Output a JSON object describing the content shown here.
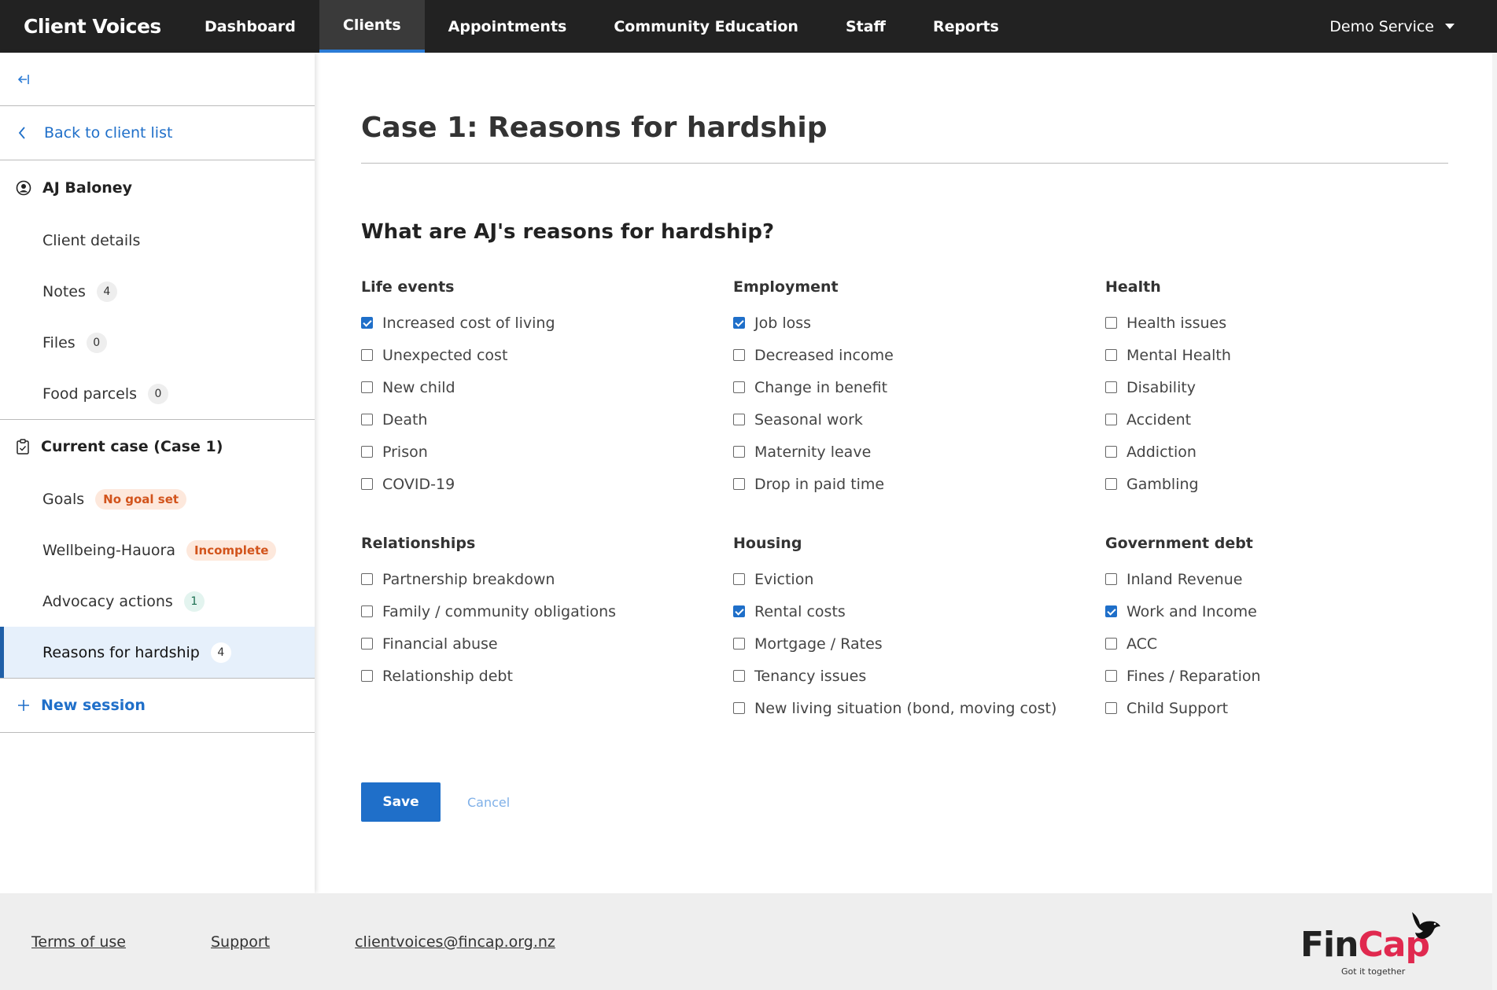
{
  "nav": {
    "brand": "Client Voices",
    "links": [
      "Dashboard",
      "Clients",
      "Appointments",
      "Community Education",
      "Staff",
      "Reports"
    ],
    "active": "Clients",
    "account": "Demo Service"
  },
  "sidebar": {
    "collapse_icon": "collapse-left-icon",
    "back": "Back to client list",
    "client_name": "AJ Baloney",
    "client_items": [
      {
        "label": "Client details"
      },
      {
        "label": "Notes",
        "count": "4"
      },
      {
        "label": "Files",
        "count": "0"
      },
      {
        "label": "Food parcels",
        "count": "0"
      }
    ],
    "case_title": "Current case (Case 1)",
    "case_items": [
      {
        "label": "Goals",
        "badge": "No goal set"
      },
      {
        "label": "Wellbeing-Hauora",
        "badge": "Incomplete"
      },
      {
        "label": "Advocacy actions",
        "count": "1"
      },
      {
        "label": "Reasons for hardship",
        "count": "4"
      }
    ],
    "new_session": "New session"
  },
  "main": {
    "title": "Case 1: Reasons for hardship",
    "question": "What are AJ's reasons for hardship?",
    "groups": [
      {
        "title": "Life events",
        "options": [
          {
            "label": "Increased cost of living",
            "checked": true
          },
          {
            "label": "Unexpected cost",
            "checked": false
          },
          {
            "label": "New child",
            "checked": false
          },
          {
            "label": "Death",
            "checked": false
          },
          {
            "label": "Prison",
            "checked": false
          },
          {
            "label": "COVID-19",
            "checked": false
          }
        ]
      },
      {
        "title": "Employment",
        "options": [
          {
            "label": "Job loss",
            "checked": true
          },
          {
            "label": "Decreased income",
            "checked": false
          },
          {
            "label": "Change in benefit",
            "checked": false
          },
          {
            "label": "Seasonal work",
            "checked": false
          },
          {
            "label": "Maternity leave",
            "checked": false
          },
          {
            "label": "Drop in paid time",
            "checked": false
          }
        ]
      },
      {
        "title": "Health",
        "options": [
          {
            "label": "Health issues",
            "checked": false
          },
          {
            "label": "Mental Health",
            "checked": false
          },
          {
            "label": "Disability",
            "checked": false
          },
          {
            "label": "Accident",
            "checked": false
          },
          {
            "label": "Addiction",
            "checked": false
          },
          {
            "label": "Gambling",
            "checked": false
          }
        ]
      },
      {
        "title": "Relationships",
        "options": [
          {
            "label": "Partnership breakdown",
            "checked": false
          },
          {
            "label": "Family / community obligations",
            "checked": false
          },
          {
            "label": "Financial abuse",
            "checked": false
          },
          {
            "label": "Relationship debt",
            "checked": false
          }
        ]
      },
      {
        "title": "Housing",
        "options": [
          {
            "label": "Eviction",
            "checked": false
          },
          {
            "label": "Rental costs",
            "checked": true
          },
          {
            "label": "Mortgage / Rates",
            "checked": false
          },
          {
            "label": "Tenancy issues",
            "checked": false
          },
          {
            "label": "New living situation (bond, moving cost)",
            "checked": false
          }
        ]
      },
      {
        "title": "Government debt",
        "options": [
          {
            "label": "Inland Revenue",
            "checked": false
          },
          {
            "label": "Work and Income",
            "checked": true
          },
          {
            "label": "ACC",
            "checked": false
          },
          {
            "label": "Fines / Reparation",
            "checked": false
          },
          {
            "label": "Child Support",
            "checked": false
          }
        ]
      }
    ],
    "save": "Save",
    "cancel": "Cancel"
  },
  "footer": {
    "links": [
      "Terms of use",
      "Support",
      "clientvoices@fincap.org.nz"
    ],
    "logo": {
      "fin": "Fin",
      "cap": "Cap",
      "tagline": "Got it together"
    }
  }
}
